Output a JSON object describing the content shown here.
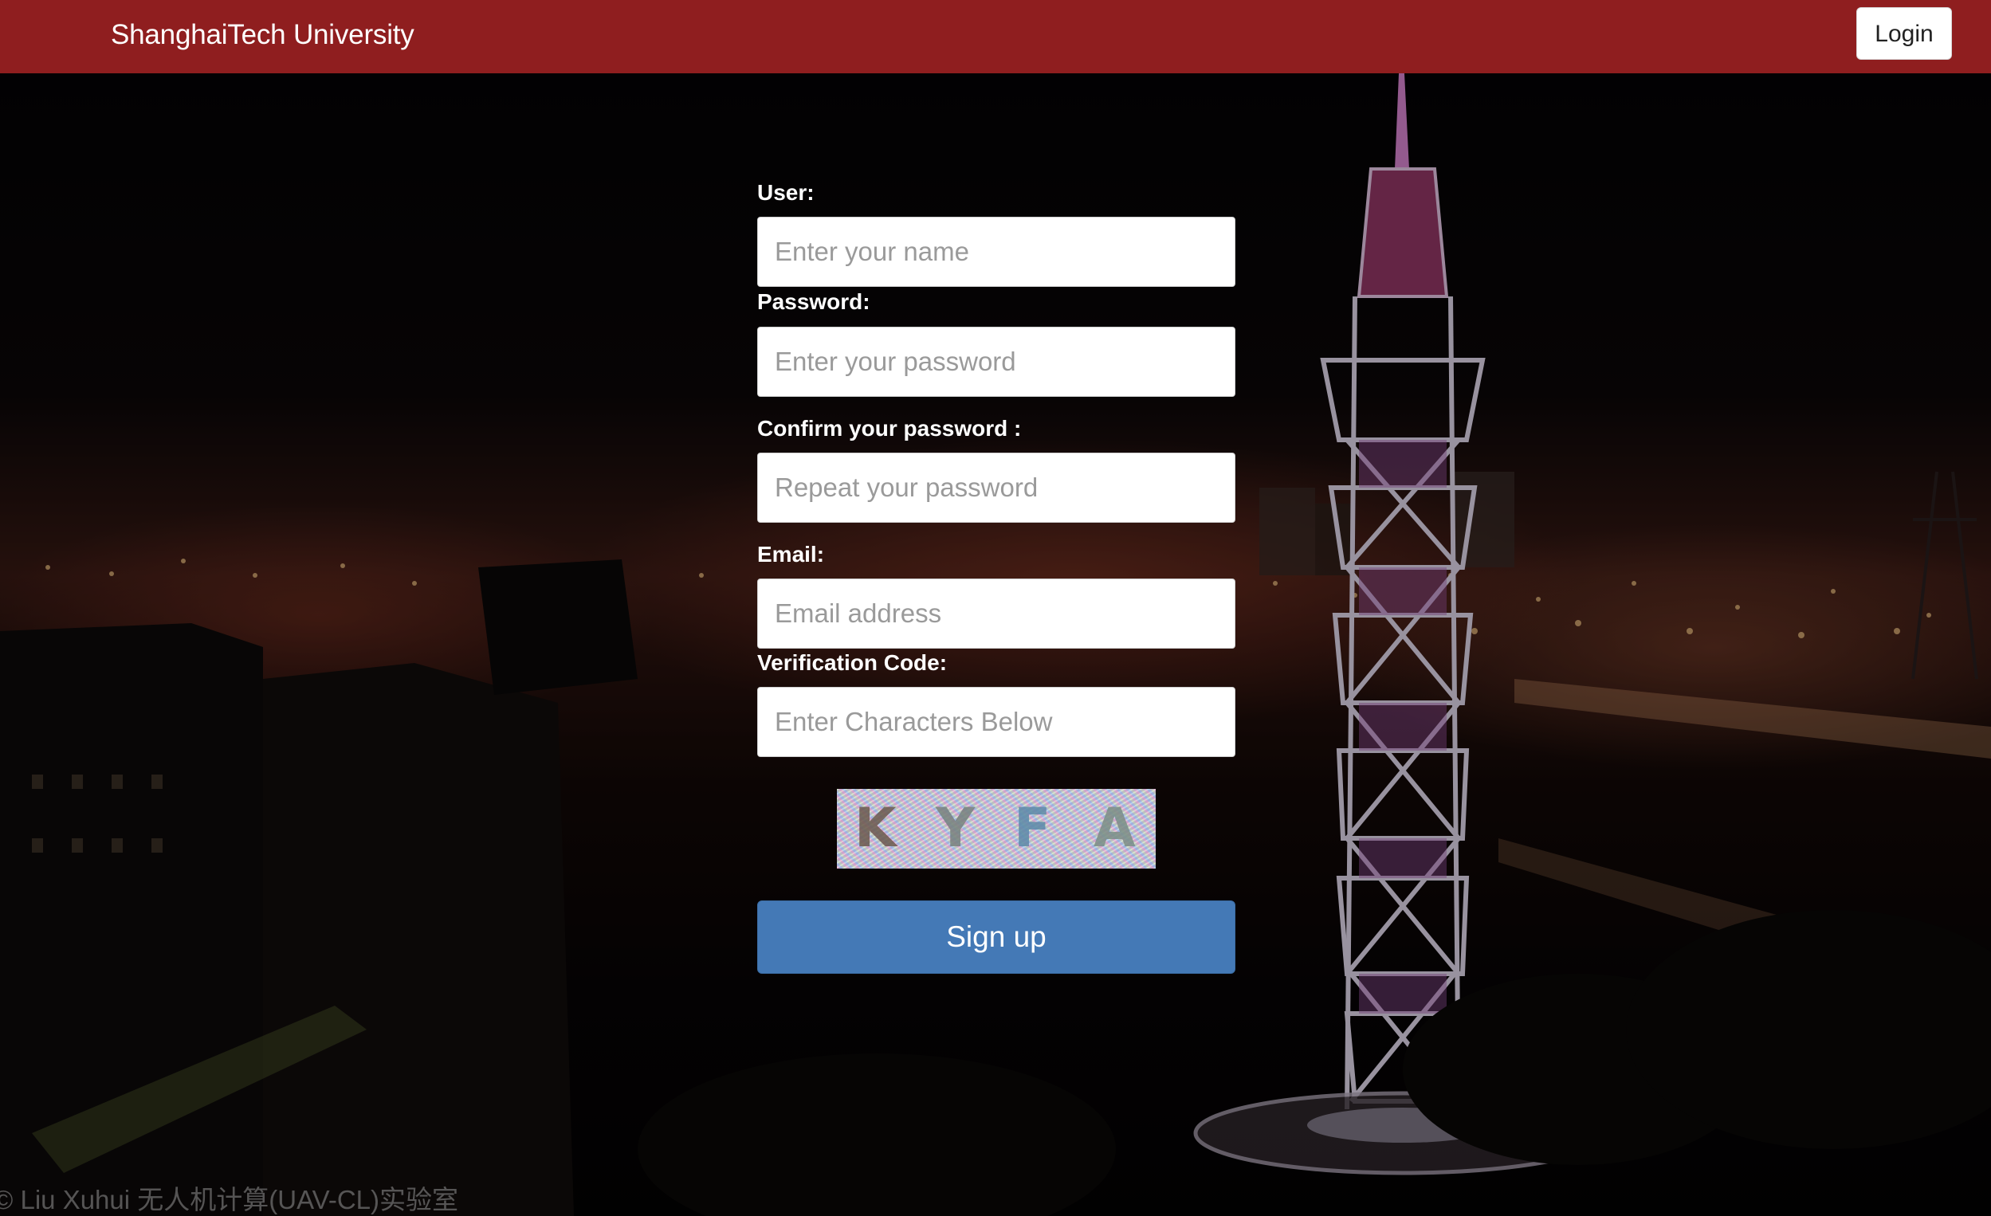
{
  "navbar": {
    "brand": "ShanghaiTech University",
    "login_label": "Login",
    "bg_color": "#8f1e1f"
  },
  "form": {
    "user": {
      "label": "User:",
      "placeholder": "Enter your name"
    },
    "password": {
      "label": "Password:",
      "placeholder": "Enter your password"
    },
    "confirm": {
      "label": "Confirm your password :",
      "placeholder": "Repeat your password"
    },
    "email": {
      "label": "Email:",
      "placeholder": "Email address"
    },
    "verification": {
      "label": "Verification Code:",
      "placeholder": "Enter Characters Below"
    },
    "captcha": {
      "chars": [
        "K",
        "Y",
        "F",
        "A"
      ]
    },
    "submit_label": "Sign up",
    "submit_color": "#4479b6"
  },
  "footer": {
    "credit": "© Liu Xuhui 无人机计算(UAV-CL)实验室"
  }
}
